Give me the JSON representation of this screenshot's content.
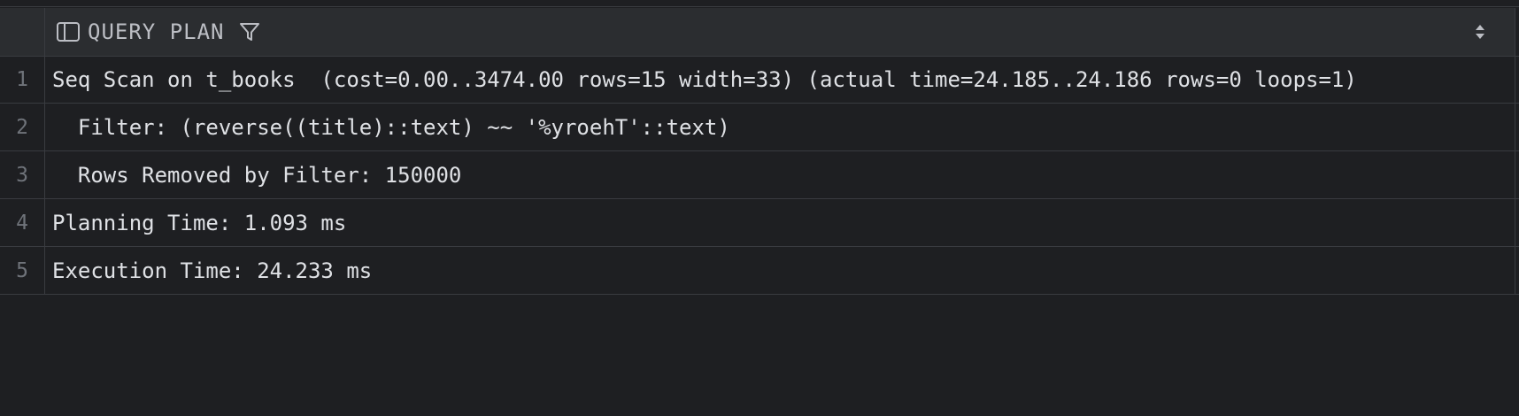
{
  "column": {
    "title": "QUERY PLAN",
    "icon": "panel-layout-icon",
    "filter_icon": "filter-icon",
    "sort_icon": "sort-arrows-icon"
  },
  "rows": [
    {
      "num": "1",
      "text": "Seq Scan on t_books  (cost=0.00..3474.00 rows=15 width=33) (actual time=24.185..24.186 rows=0 loops=1)"
    },
    {
      "num": "2",
      "text": "  Filter: (reverse((title)::text) ~~ '%yroehT'::text)"
    },
    {
      "num": "3",
      "text": "  Rows Removed by Filter: 150000"
    },
    {
      "num": "4",
      "text": "Planning Time: 1.093 ms"
    },
    {
      "num": "5",
      "text": "Execution Time: 24.233 ms"
    }
  ],
  "colors": {
    "background": "#1e1f22",
    "header_background": "#2b2d30",
    "grid_line": "#393b40",
    "text": "#dfe1e5",
    "row_number": "#6f737a"
  }
}
